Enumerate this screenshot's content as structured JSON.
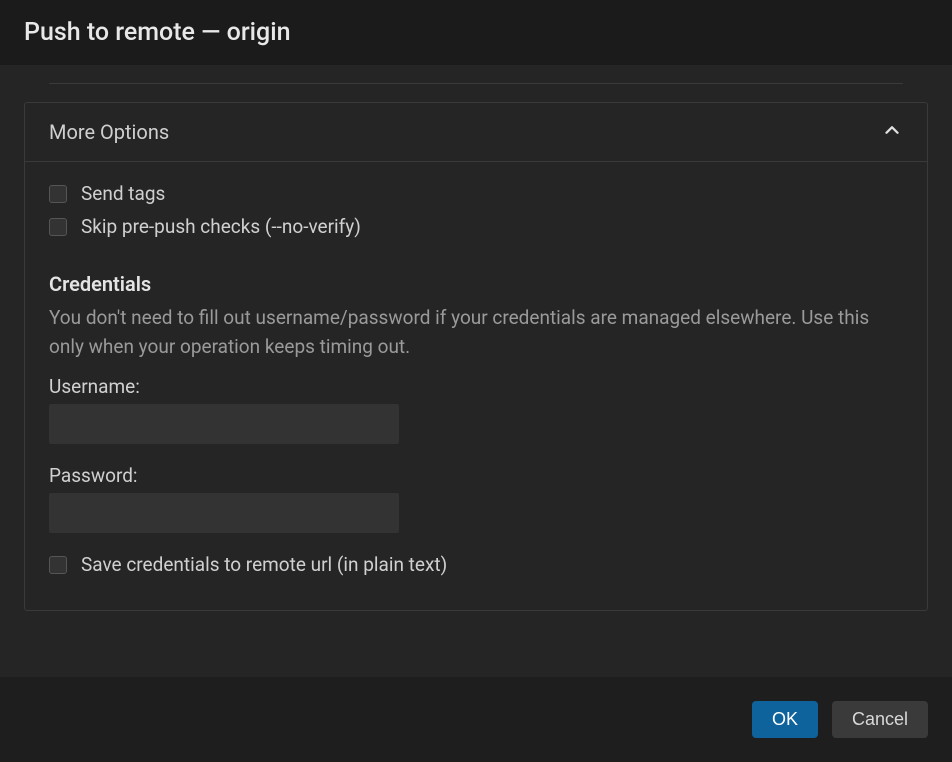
{
  "title": "Push to remote — origin",
  "more_options": {
    "header": "More Options",
    "send_tags_label": "Send tags",
    "skip_hooks_label": "Skip pre-push checks (--no-verify)",
    "credentials": {
      "heading": "Credentials",
      "help": "You don't need to fill out username/password if your credentials are managed elsewhere. Use this only when your operation keeps timing out.",
      "username_label": "Username:",
      "username_value": "",
      "password_label": "Password:",
      "password_value": "",
      "save_label": "Save credentials to remote url (in plain text)"
    }
  },
  "buttons": {
    "ok": "OK",
    "cancel": "Cancel"
  }
}
